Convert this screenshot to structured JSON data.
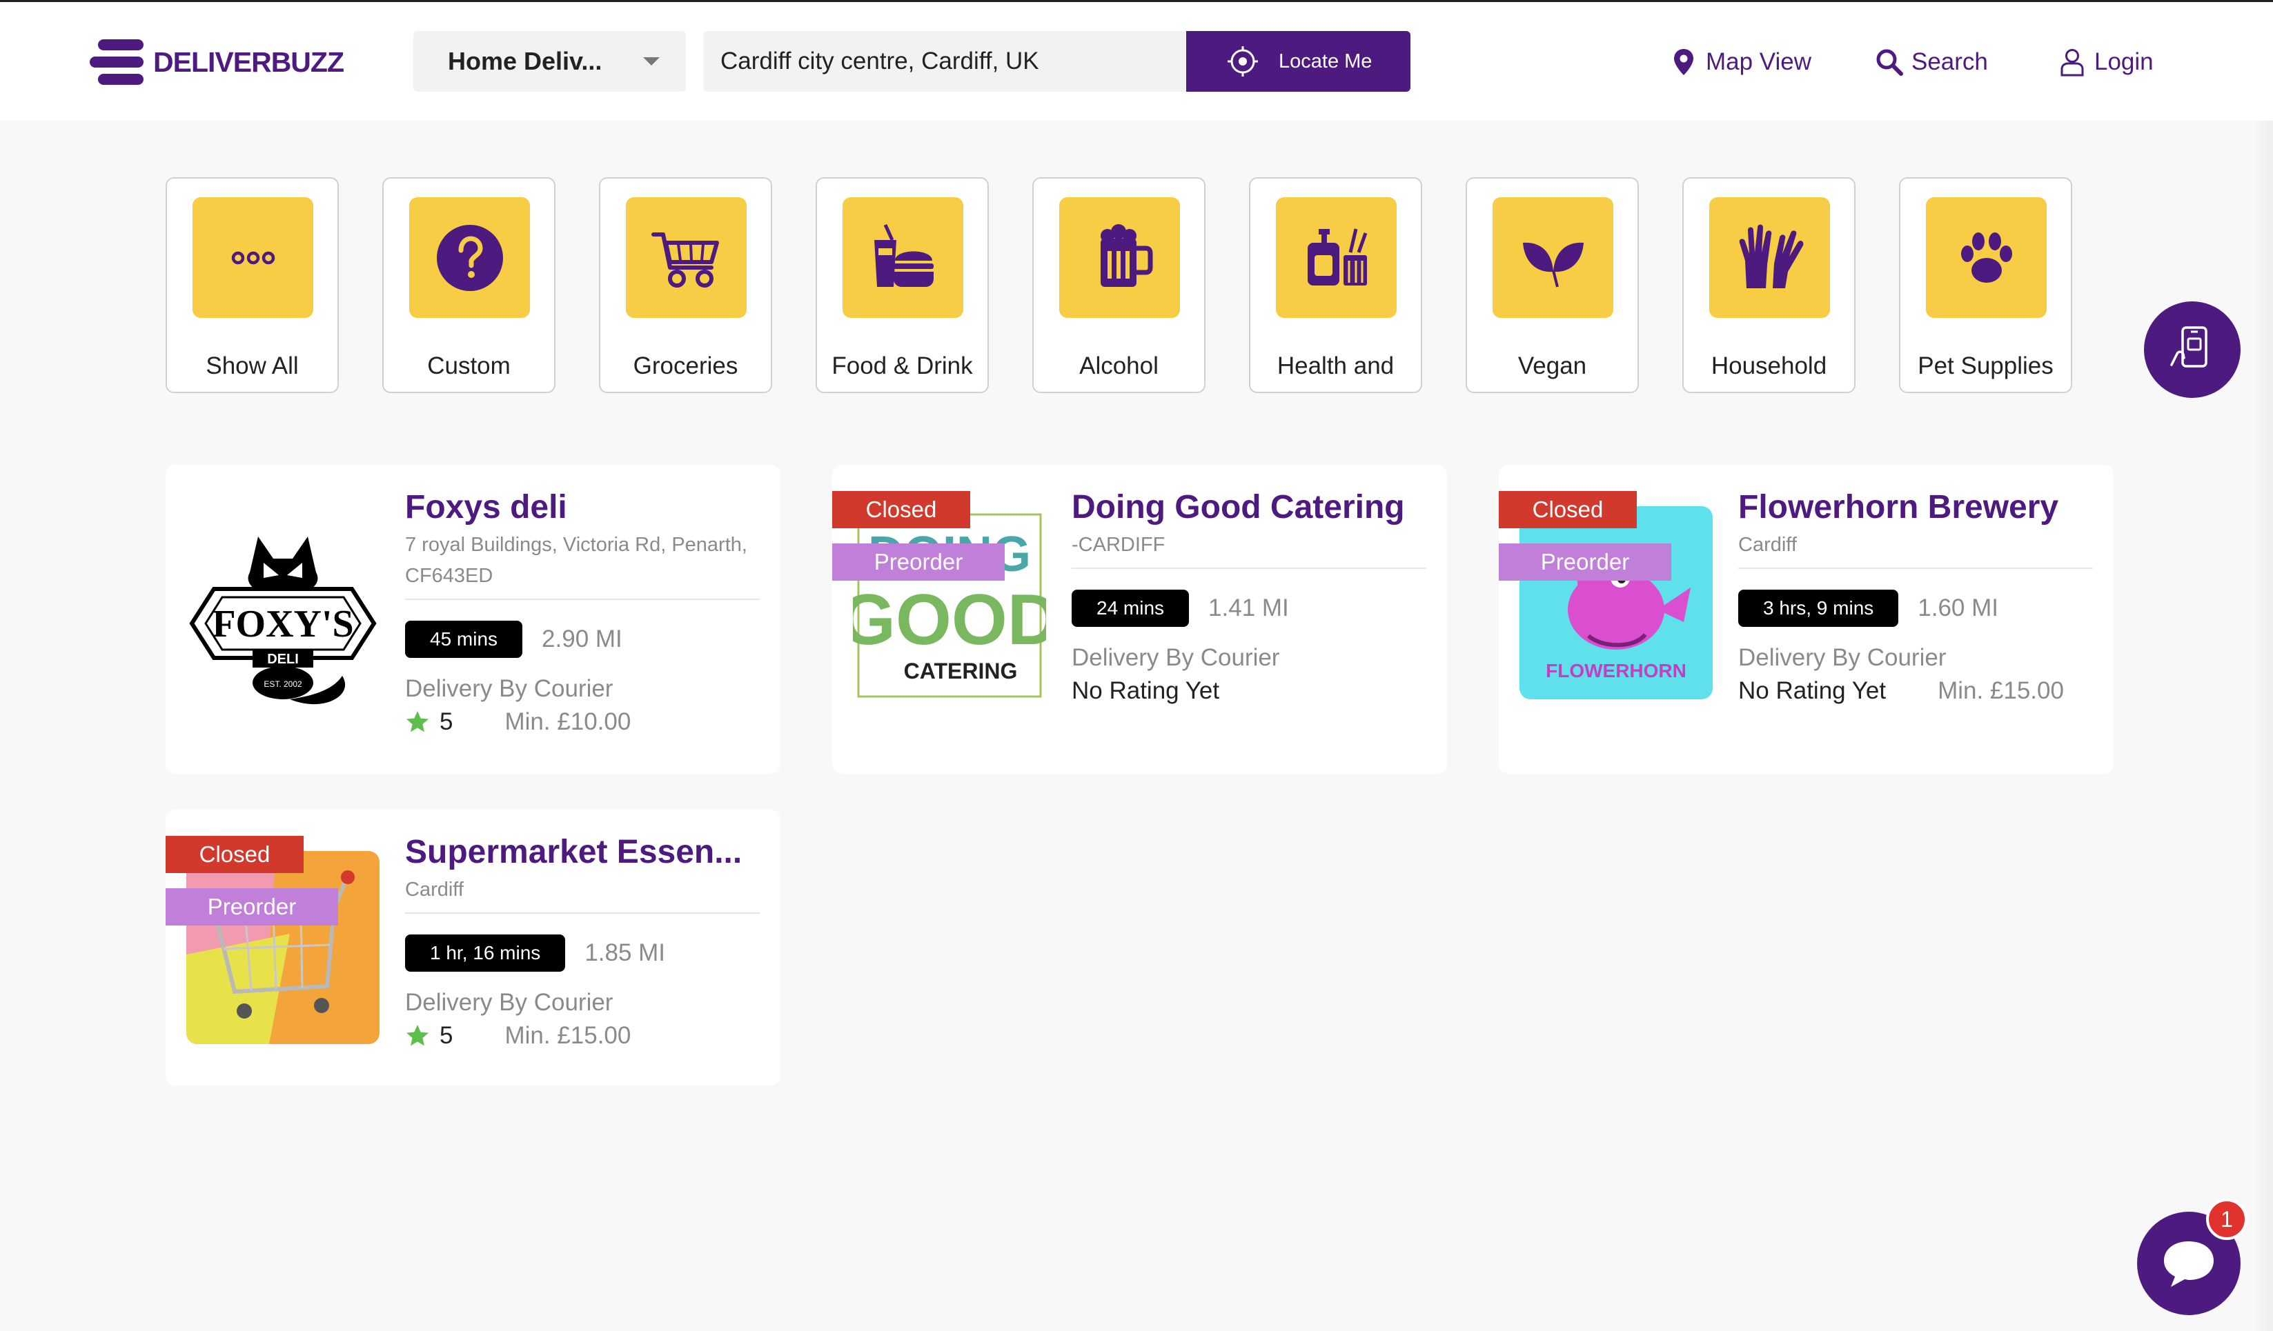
{
  "brand": {
    "name": "DELIVERBUZZ",
    "accent": "#4d1a7f",
    "tile_color": "#f7cd46"
  },
  "header": {
    "mode": "Home Deliv...",
    "address": "Cardiff city centre, Cardiff, UK",
    "locate_label": "Locate Me",
    "nav": {
      "map": "Map View",
      "search": "Search",
      "login": "Login"
    }
  },
  "categories": [
    {
      "label": "Show All",
      "icon": "dots-icon"
    },
    {
      "label": "Custom",
      "icon": "question-icon"
    },
    {
      "label": "Groceries",
      "icon": "cart-icon"
    },
    {
      "label": "Food & Drink",
      "icon": "burger-drink-icon"
    },
    {
      "label": "Alcohol",
      "icon": "beer-icon"
    },
    {
      "label": "Health and",
      "icon": "health-icon"
    },
    {
      "label": "Vegan",
      "icon": "leaf-icon"
    },
    {
      "label": "Household",
      "icon": "gloves-icon"
    },
    {
      "label": "Pet Supplies",
      "icon": "paw-icon"
    }
  ],
  "badges": {
    "closed": "Closed",
    "preorder": "Preorder"
  },
  "stores": [
    {
      "name": "Foxys deli",
      "address": "7 royal Buildings, Victoria Rd, Penarth, CF643ED",
      "time": "45 mins",
      "distance": "2.90 MI",
      "delivery": "Delivery By Courier",
      "rating": "5",
      "min": "Min. £10.00",
      "logo_text": {
        "main": "FOXY'S",
        "sub": "DELI",
        "est": "EST. 2002"
      }
    },
    {
      "name": "Doing Good Catering",
      "address": "-CARDIFF",
      "time": "24 mins",
      "distance": "1.41 MI",
      "delivery": "Delivery By Courier",
      "rating": "No Rating Yet",
      "logo_text": {
        "top": "DOING",
        "main": "GOOD",
        "sub": "CATERING"
      }
    },
    {
      "name": "Flowerhorn Brewery",
      "address": "Cardiff",
      "time": "3 hrs, 9 mins",
      "distance": "1.60 MI",
      "delivery": "Delivery By Courier",
      "rating": "No Rating Yet",
      "min": "Min. £15.00",
      "logo_text": {
        "main": "FLOWERHORN"
      }
    },
    {
      "name": "Supermarket Essen...",
      "address": "Cardiff",
      "time": "1 hr, 16 mins",
      "distance": "1.85 MI",
      "delivery": "Delivery By Courier",
      "rating": "5",
      "min": "Min. £15.00"
    }
  ],
  "chat": {
    "unread": "1"
  }
}
